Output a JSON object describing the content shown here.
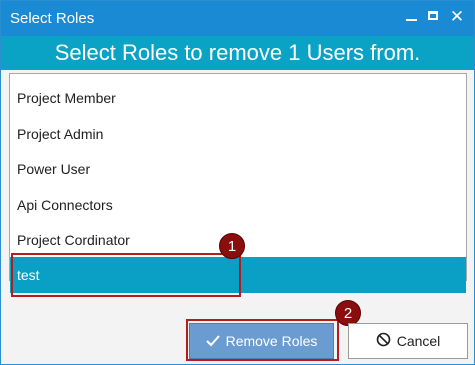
{
  "window": {
    "title": "Select Roles",
    "minimize_icon": "minimize-icon",
    "maximize_icon": "maximize-icon",
    "close_glyph": "✕"
  },
  "header": {
    "text": "Select Roles to remove 1 Users from."
  },
  "roles": {
    "items": [
      {
        "label": "Project Member",
        "selected": false
      },
      {
        "label": "Project Admin",
        "selected": false
      },
      {
        "label": "Power User",
        "selected": false
      },
      {
        "label": "Api Connectors",
        "selected": false
      },
      {
        "label": "Project Cordinator",
        "selected": false
      },
      {
        "label": "test",
        "selected": true
      }
    ]
  },
  "callouts": {
    "first": "1",
    "second": "2"
  },
  "buttons": {
    "remove_label": "Remove Roles",
    "remove_icon": "checkmark-icon",
    "cancel_label": "Cancel",
    "cancel_icon": "cancel-circle-icon"
  },
  "colors": {
    "titlebar": "#1a8ad4",
    "header_band": "#0aa3c6",
    "selected_row": "#0a9fc4",
    "callout": "#8b0e0e"
  }
}
